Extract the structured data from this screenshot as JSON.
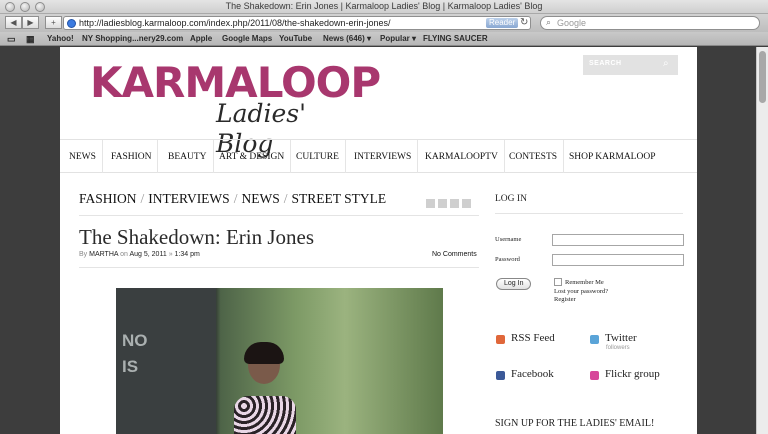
{
  "window": {
    "title": "The Shakedown: Erin Jones | Karmaloop Ladies' Blog | Karmaloop Ladies' Blog"
  },
  "toolbar": {
    "back_glyph": "◀",
    "forward_glyph": "▶",
    "add_glyph": "+",
    "url": "http://ladiesblog.karmaloop.com/index.php/2011/08/the-shakedown-erin-jones/",
    "reader_label": "Reader",
    "reload_glyph": "↻",
    "search_placeholder": "Google"
  },
  "bookmarks": {
    "items": [
      "Yahoo!",
      "NY Shopping...nery29.com",
      "Apple",
      "Google Maps",
      "YouTube",
      "News (646) ▾",
      "Popular ▾",
      "FLYING SAUCER"
    ]
  },
  "site": {
    "logo_main": "KARMALOOP",
    "logo_sub": "Ladies' Blog",
    "search_label": "SEARCH",
    "nav": [
      "NEWS",
      "FASHION",
      "BEAUTY",
      "ART & DESIGN",
      "CULTURE",
      "INTERVIEWS",
      "KARMALOOPTV",
      "CONTESTS",
      "SHOP KARMALOOP"
    ]
  },
  "post": {
    "categories": [
      "FASHION",
      "INTERVIEWS",
      "NEWS",
      "STREET STYLE"
    ],
    "title": "The Shakedown: Erin Jones",
    "by": "By",
    "author": "MARTHA",
    "on": "on",
    "date": "Aug 5, 2011",
    "time_sep": "»",
    "time": "1:34 pm",
    "comments": "No Comments",
    "photo_text": "NO\nIS"
  },
  "sidebar": {
    "login_title": "LOG IN",
    "username_label": "Username",
    "password_label": "Password",
    "remember_label": "Remember Me",
    "lost_password": "Lost your password?",
    "register": "Register",
    "login_button": "Log In",
    "rss": "RSS Feed",
    "twitter": "Twitter",
    "twitter_sub": "followers",
    "facebook": "Facebook",
    "flickr": "Flickr group",
    "signup": "SIGN UP FOR THE LADIES' EMAIL!"
  },
  "colors": {
    "brand": "#a8376e",
    "rss": "#e0673a",
    "twitter": "#5aa4d8",
    "facebook": "#3b5998",
    "flickr": "#d7479a"
  },
  "icons": [
    "globe-icon",
    "search-icon",
    "rss-icon",
    "twitter-icon",
    "facebook-icon",
    "flickr-icon"
  ]
}
